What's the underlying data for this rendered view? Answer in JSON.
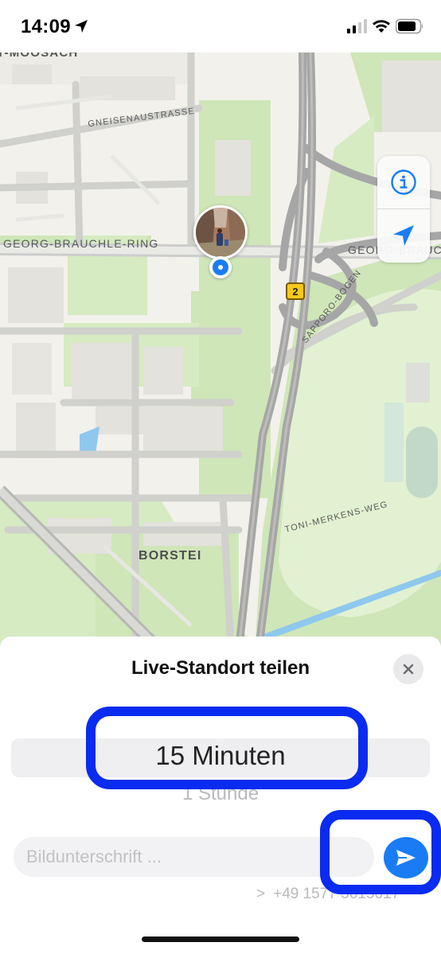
{
  "status_bar": {
    "time": "14:09",
    "icons": [
      "location-arrow-icon",
      "signal-icon",
      "wifi-icon",
      "battery-icon"
    ]
  },
  "map": {
    "labels": {
      "district_top": "T-MOOSACH",
      "gneisenau": "GNEISENAUSTRASSE",
      "georg_left": "GEORG-BRAUCHLE-RING",
      "georg_right": "GEORG-BRAUCH",
      "sapporo": "SAPPORO-BOGEN",
      "toni": "TONI-MERKENS-WEG",
      "borstei": "BORSTEI"
    },
    "route_badge": "2",
    "controls": [
      "info-icon",
      "location-arrow-icon"
    ],
    "colors": {
      "park": "#cfe6b8",
      "road": "#d0d0cc",
      "highway": "#a6a6a6",
      "water": "#8ec8ee"
    }
  },
  "sheet": {
    "title": "Live-Standort teilen",
    "picker": {
      "selected": "15 Minuten",
      "next": "1 Stunde"
    },
    "caption_placeholder": "Bildunterschrift ...",
    "recipient": "+49 1577 3615617",
    "accent_color": "#1a7cf5"
  },
  "annotation_color": "#0a2bf0"
}
